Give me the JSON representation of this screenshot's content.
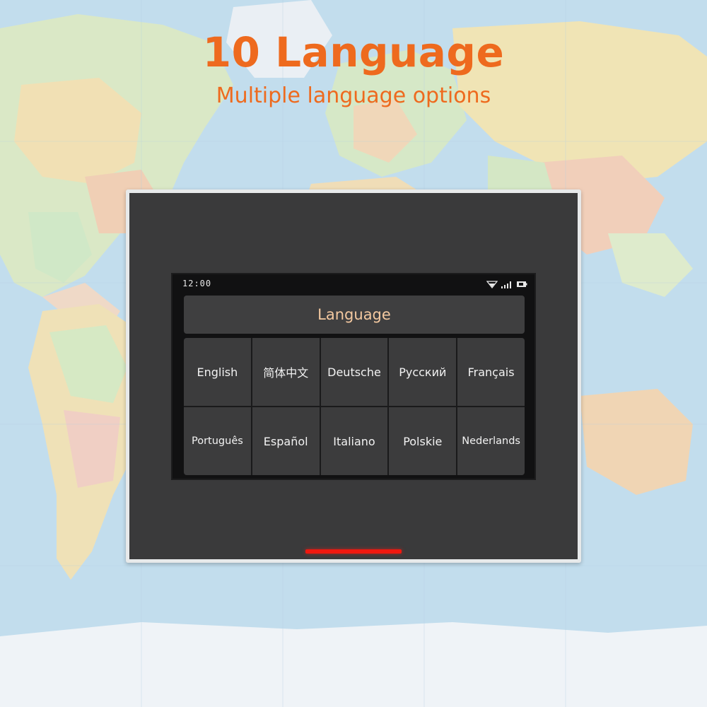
{
  "headline": {
    "title": "10 Language",
    "subtitle": "Multiple language options"
  },
  "colors": {
    "accent": "#ee6a1e",
    "screen_title": "#f4c9a0",
    "indicator": "#f0180f",
    "device_face": "#3a3a3b"
  },
  "device": {
    "statusbar": {
      "time": "12:00",
      "icons": [
        "wifi-icon",
        "signal-icon",
        "battery-icon"
      ]
    },
    "screen_title": "Language",
    "languages": [
      "English",
      "简体中文",
      "Deutsche",
      "Русский",
      "Français",
      "Português",
      "Español",
      "Italiano",
      "Polskie",
      "Nederlands"
    ]
  }
}
